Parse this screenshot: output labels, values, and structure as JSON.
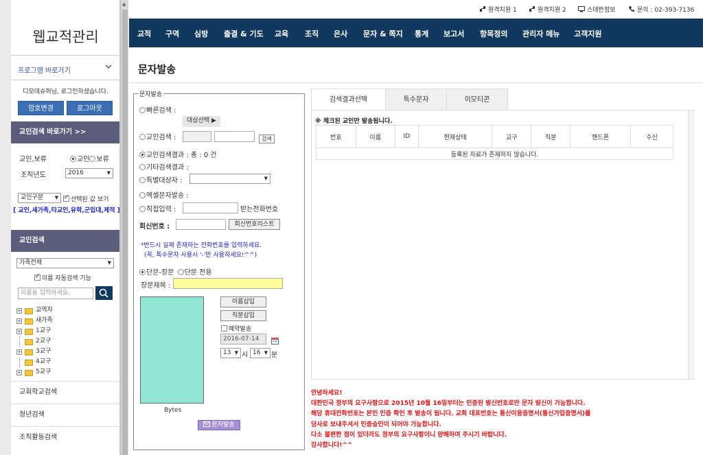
{
  "app": {
    "title": "웹교적관리"
  },
  "top_links": [
    {
      "label": "원격지원 1",
      "icon": "remote-support-icon"
    },
    {
      "label": "원격지원 2",
      "icon": "remote-support-icon"
    },
    {
      "label": "스데반정보",
      "icon": "monitor-icon"
    },
    {
      "label": "문의 : 02-393-7136",
      "icon": "phone-icon"
    }
  ],
  "nav": [
    "교적",
    "구역",
    "심방",
    "출결 & 기도",
    "교육",
    "조직",
    "은사",
    "문자 & 쪽지",
    "통계",
    "보고서",
    "항목정의",
    "관리자 메뉴",
    "고객지원"
  ],
  "sidebar": {
    "shortcut_label": "프로그램 바로가기",
    "welcome": "디모데슈퍼님, 로그인하셨습니다.",
    "btn_password": "암호변경",
    "btn_logout": "로그아웃",
    "member_search_shortcut": "교인검색 바로가기 >>",
    "member_type_label": "교인,보류",
    "radio_member": "교인",
    "radio_hold": "보류",
    "org_year_label": "조직년도",
    "org_year_value": "2016",
    "category_select": "교인구분",
    "show_selected_label": "선택된 값 보기",
    "category_list": "[ 교인,새가족,타교인,유학,군입대,제적 ]",
    "member_search_header": "교인검색",
    "family_select": "가족전체",
    "auto_search_label": "이름 자동검색 기능",
    "name_placeholder": "이름을 입력하세요.",
    "tree": [
      {
        "label": "교역자",
        "expandable": true
      },
      {
        "label": "새가족",
        "expandable": true
      },
      {
        "label": "1교구",
        "expandable": true
      },
      {
        "label": "2교구",
        "expandable": false
      },
      {
        "label": "3교구",
        "expandable": true
      },
      {
        "label": "4교구",
        "expandable": false
      },
      {
        "label": "5교구",
        "expandable": true
      }
    ],
    "links": [
      "교회학교검색",
      "청년검색",
      "조직활동검색"
    ]
  },
  "main": {
    "page_title": "문자발송",
    "fieldset_legend": "문자발송",
    "quick_search_label": "빠른검색 :",
    "target_select_btn": "대상선택 ▶",
    "member_search_label": "교인검색 :",
    "search_btn": "검색",
    "member_search_result": "교인검색결과 : 총 : 0 건",
    "other_search_result": "기타검색결과 :",
    "special_target_label": "특별대상자 :",
    "excel_send_label": "엑셀문자발송 :",
    "direct_input_label": "직접입력 :",
    "receiver_number_label": "받는전화번호",
    "callback_label": "회신번호 :",
    "callback_list_btn": "회신번호리스트",
    "note_line1": "*반드시 실제 존재하는 전화번호를 입력하세요.",
    "note_line2": "(꼭, 특수문자 사용시 '-'만 사용하세요!^^)",
    "radio_short_long": "단문-장문",
    "radio_short_only": "단문 전용",
    "long_title_label": "장문제목 :",
    "insert_name_btn": "이름삽입",
    "insert_title_btn": "직분삽입",
    "reserve_label": "예약발송",
    "reserve_date": "2016-07-14",
    "reserve_hour": "13",
    "hour_unit": "시",
    "reserve_minute": "16",
    "minute_unit": "분",
    "bytes_label": "Bytes",
    "send_btn": "문자발송"
  },
  "tabs": [
    {
      "label": "검색결과선택",
      "active": true
    },
    {
      "label": "특수문자",
      "active": false
    },
    {
      "label": "이모티콘",
      "active": false
    }
  ],
  "result": {
    "note": "※ 체크된 교인만 발송됩니다.",
    "columns": [
      "번호",
      "이름",
      "ID",
      "현재상태",
      "교구",
      "직분",
      "핸드폰",
      "수신"
    ],
    "empty_message": "등록된 자료가 존재하지 않습니다."
  },
  "notice": [
    "안녕하세요!",
    "대한민국 정부의 요구사항으로 2015년 10월 16일부터는 인증된 발신번호로만 문자 발신이 가능합니다.",
    "해당 휴대전화번호는 본인 인증 확인 후 발송이 됩니다. 교회 대표번호는 통신이용증명서(통신가입증명서)를",
    "당사로 보내주셔서 인증승인이 되어야 가능합니다.",
    "다소 불편한 점이 있더라도 정부의 요구사항이니 양해하여 주시기 바랍니다.",
    "감사합니다!^^"
  ],
  "colors": {
    "nav_bg": "#11395f",
    "sidebar_header_bg": "#5c5c7c",
    "button_blue": "#3a6fb3",
    "textarea_bg": "#92e6d4",
    "notice_red": "#e01212",
    "note_blue": "#1d22c9"
  }
}
